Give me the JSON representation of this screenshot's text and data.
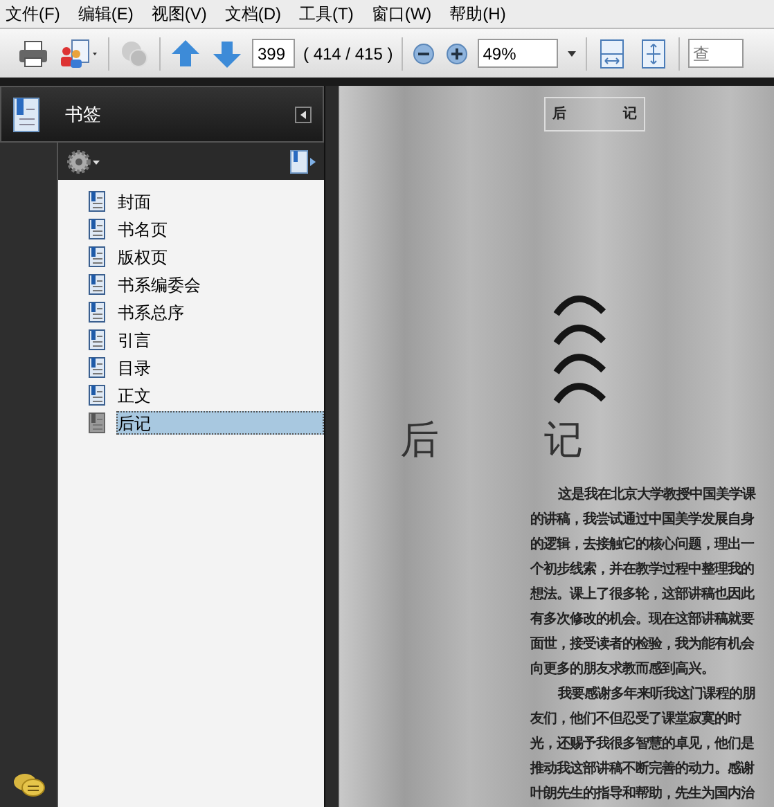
{
  "menu": [
    "文件(F)",
    "编辑(E)",
    "视图(V)",
    "文档(D)",
    "工具(T)",
    "窗口(W)",
    "帮助(H)"
  ],
  "toolbar": {
    "page_number": "399",
    "page_count": "( 414 / 415 )",
    "zoom": "49%",
    "search_placeholder": "查"
  },
  "bookmarks_panel": {
    "title": "书签",
    "items": [
      {
        "label": "封面",
        "selected": false
      },
      {
        "label": "书名页",
        "selected": false
      },
      {
        "label": "版权页",
        "selected": false
      },
      {
        "label": "书系编委会",
        "selected": false
      },
      {
        "label": "书系总序",
        "selected": false
      },
      {
        "label": "引言",
        "selected": false
      },
      {
        "label": "目录",
        "selected": false
      },
      {
        "label": "正文",
        "selected": false
      },
      {
        "label": "后记",
        "selected": true
      }
    ]
  },
  "document_page": {
    "running_head": [
      "后",
      "记"
    ],
    "title": [
      "后",
      "记"
    ],
    "lines": [
      {
        "text": "这是我在北京大学教授中国美学课",
        "indent": true
      },
      {
        "text": "的讲稿，我尝试通过中国美学发展自身",
        "indent": false
      },
      {
        "text": "的逻辑，去接触它的核心问题，理出一",
        "indent": false
      },
      {
        "text": "个初步线索，并在教学过程中整理我的",
        "indent": false
      },
      {
        "text": "想法。课上了很多轮，这部讲稿也因此",
        "indent": false
      },
      {
        "text": "有多次修改的机会。现在这部讲稿就要",
        "indent": false
      },
      {
        "text": "面世，接受读者的检验，我为能有机会",
        "indent": false
      },
      {
        "text": "向更多的朋友求教而感到高兴。",
        "indent": false
      },
      {
        "text": "我要感谢多年来听我这门课程的朋",
        "indent": true
      },
      {
        "text": "友们，他们不但忍受了课堂寂寞的时",
        "indent": false
      },
      {
        "text": "光，还赐予我很多智慧的卓见，他们是",
        "indent": false
      },
      {
        "text": "推动我这部讲稿不断完善的动力。感谢",
        "indent": false
      },
      {
        "text": "叶朗先生的指导和帮助，先生为国内治",
        "indent": false
      }
    ]
  }
}
